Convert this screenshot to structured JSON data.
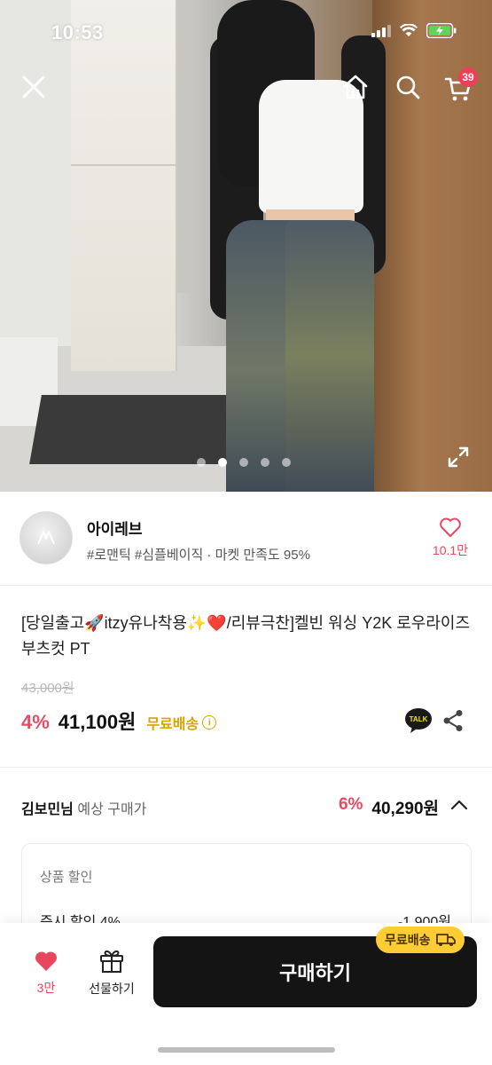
{
  "status_bar": {
    "time": "10:53",
    "icons": [
      "signal-icon",
      "wifi-icon",
      "battery-charging-icon"
    ]
  },
  "header": {
    "icons": [
      "close-icon",
      "home-icon",
      "search-icon",
      "cart-icon"
    ],
    "cart_count": "39"
  },
  "carousel": {
    "slide_count": 5,
    "active_index": 1
  },
  "shop": {
    "name": "아이레브",
    "tags": "#로맨틱 #심플베이직 · 마켓 만족도 95%",
    "like_count": "10.1만"
  },
  "product": {
    "title": "[당일출고🚀itzy유나착용✨❤️/리뷰극찬]켈빈 워싱 Y2K 로우라이즈 부츠컷 PT",
    "original_price": "43,000원",
    "discount_rate": "4%",
    "price": "41,100원",
    "free_shipping": "무료배송",
    "talk_label": "TALK"
  },
  "expected_price": {
    "user": "김보민님",
    "label": "예상 구매가",
    "discount_rate": "6%",
    "price": "40,290원"
  },
  "discount_box": {
    "title": "상품 할인",
    "row_label": "즉시 할인 4%",
    "row_value": "-1,900원"
  },
  "bottom_bar": {
    "like_count": "3만",
    "gift_label": "선물하기",
    "buy_label": "구매하기",
    "shipping_pill": "무료배송"
  },
  "colors": {
    "accent_pink": "#ea4a62",
    "free_ship_yellow": "#d9a300",
    "buy_button": "#141414",
    "badge_red": "#ef3e56"
  }
}
